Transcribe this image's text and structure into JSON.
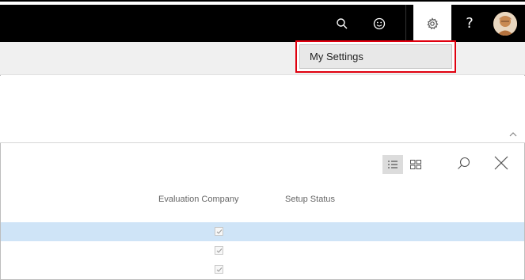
{
  "topbar": {
    "icons": [
      "search-icon",
      "smiley-icon",
      "gear-icon",
      "help-icon",
      "avatar"
    ],
    "help_label": "?"
  },
  "settings_menu": {
    "item_label": "My Settings",
    "highlight_color": "#e0000f"
  },
  "list": {
    "view_modes": [
      "list-view-icon",
      "tile-view-icon"
    ],
    "columns": [
      "Evaluation Company",
      "Setup Status"
    ],
    "rows": [
      {
        "evaluation_company": true,
        "selected": true
      },
      {
        "evaluation_company": true,
        "selected": false
      },
      {
        "evaluation_company": true,
        "selected": false
      }
    ]
  },
  "colors": {
    "topbar_bg": "#000000",
    "selected_row": "#cfe4f7",
    "action_bar": "#f0f0f0"
  }
}
